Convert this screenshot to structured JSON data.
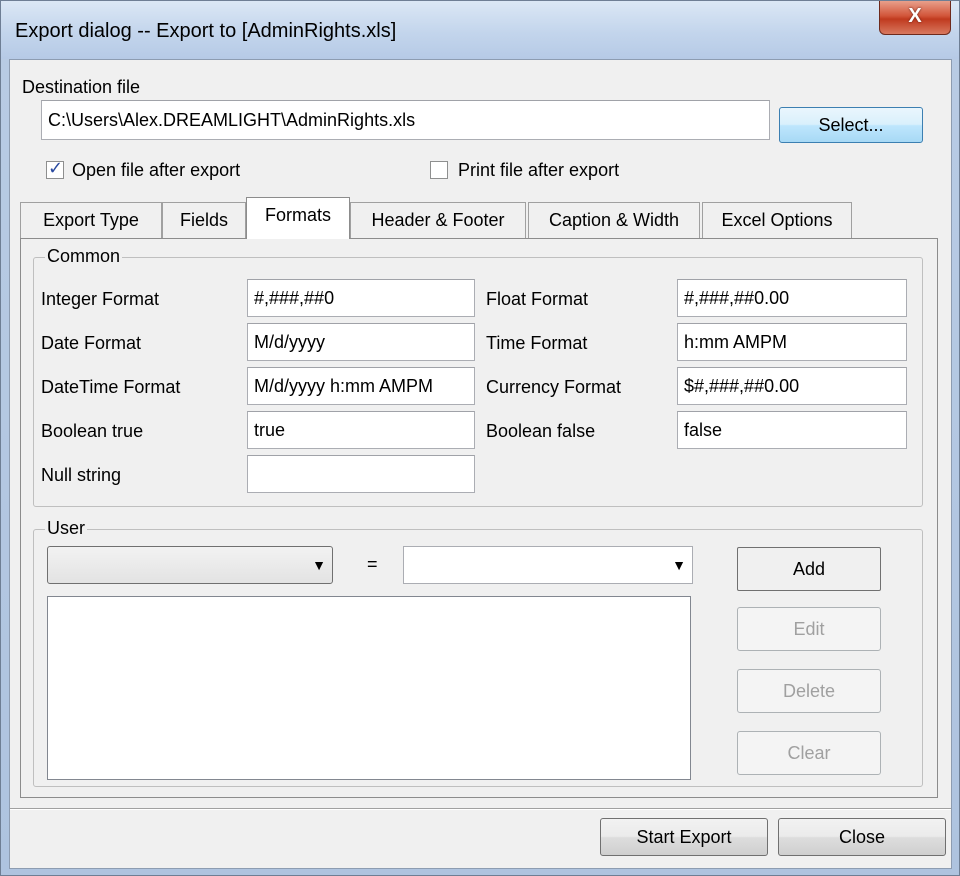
{
  "window": {
    "title": "Export dialog -- Export to [AdminRights.xls]",
    "close_glyph": "X"
  },
  "destination": {
    "label": "Destination file",
    "path": "C:\\Users\\Alex.DREAMLIGHT\\AdminRights.xls",
    "select_label": "Select...",
    "open_after_label": "Open file after export",
    "open_after_checked": true,
    "print_after_label": "Print file after export",
    "print_after_checked": false
  },
  "tabs": [
    {
      "label": "Export Type",
      "active": false
    },
    {
      "label": "Fields",
      "active": false
    },
    {
      "label": "Formats",
      "active": true
    },
    {
      "label": "Header & Footer",
      "active": false
    },
    {
      "label": "Caption & Width",
      "active": false
    },
    {
      "label": "Excel Options",
      "active": false
    }
  ],
  "common": {
    "title": "Common",
    "integer_label": "Integer Format",
    "integer_value": "#,###,##0",
    "float_label": "Float Format",
    "float_value": "#,###,##0.00",
    "date_label": "Date Format",
    "date_value": "M/d/yyyy",
    "time_label": "Time Format",
    "time_value": "h:mm AMPM",
    "datetime_label": "DateTime Format",
    "datetime_value": "M/d/yyyy h:mm AMPM",
    "currency_label": "Currency Format",
    "currency_value": "$#,###,##0.00",
    "bool_true_label": "Boolean true",
    "bool_true_value": "true",
    "bool_false_label": "Boolean false",
    "bool_false_value": "false",
    "null_label": "Null string",
    "null_value": ""
  },
  "user": {
    "title": "User",
    "equals": "=",
    "left_combo_value": "",
    "right_combo_value": "",
    "add_label": "Add",
    "edit_label": "Edit",
    "delete_label": "Delete",
    "clear_label": "Clear"
  },
  "footer": {
    "start_label": "Start Export",
    "close_label": "Close"
  },
  "icons": {
    "dropdown": "chevron-down-icon",
    "check": "checkmark-icon"
  }
}
